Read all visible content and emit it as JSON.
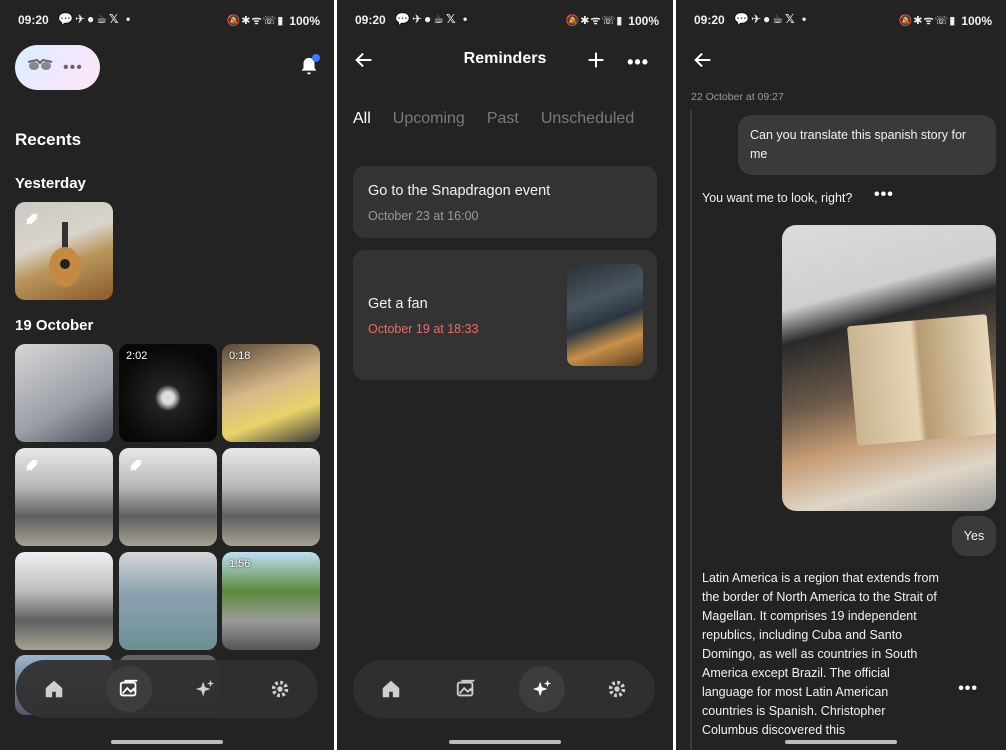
{
  "status_bar": {
    "time": "09:20",
    "notification_icons": "💬✈●☕𝕏 •",
    "system_icons": "🔕✱ᯤ☏▮",
    "battery": "100%"
  },
  "screen1": {
    "recents_heading": "Recents",
    "yesterday_heading": "Yesterday",
    "october_heading": "19 October",
    "video_durations": {
      "g2": "2:02",
      "g3": "0:18",
      "g9": "1:56"
    },
    "avatar_dots": "•••"
  },
  "screen2": {
    "title": "Reminders",
    "more_label": "•••",
    "tabs": [
      "All",
      "Upcoming",
      "Past",
      "Unscheduled"
    ],
    "reminders": [
      {
        "title": "Go to the Snapdragon event",
        "date": "October 23 at 16:00"
      },
      {
        "title": "Get a fan",
        "date": "October 19 at 18:33"
      }
    ],
    "accent_colors": {
      "overdue_date": "#e86a6a"
    }
  },
  "screen3": {
    "timestamp": "22 October at 09:27",
    "user_message": "Can you translate this spanish story for me",
    "ai_question": "You want me to look, right?",
    "more_label": "•••",
    "user_reply": "Yes",
    "ai_response": "Latin America is a region that extends from the border of North America to the Strait of Magellan. It comprises 19 independent republics, including Cuba and Santo Domingo, as well as countries in South America except Brazil. The official language for most Latin American countries is Spanish. Christopher Columbus discovered this"
  },
  "nav_icons": [
    "home-icon",
    "gallery-icon",
    "sparkle-icon",
    "gear-icon"
  ]
}
